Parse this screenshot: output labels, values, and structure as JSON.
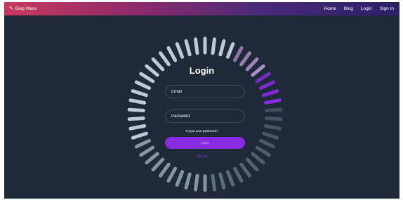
{
  "navbar": {
    "brand": "Blog Ware",
    "brand_icon": "pen-icon",
    "links": [
      {
        "label": "Home"
      },
      {
        "label": "Blog"
      },
      {
        "label": "Login"
      },
      {
        "label": "Sign In"
      }
    ]
  },
  "login": {
    "title": "Login",
    "email_placeholder": "Email",
    "password_placeholder": "Password",
    "forgot": "Forgot your password?",
    "submit": "Login",
    "signup": "Signup"
  },
  "colors": {
    "background": "#1f2a38",
    "accent": "#8a2be2",
    "ring_active": "#8a2be2",
    "ring_idle": "#c7d3e0"
  }
}
